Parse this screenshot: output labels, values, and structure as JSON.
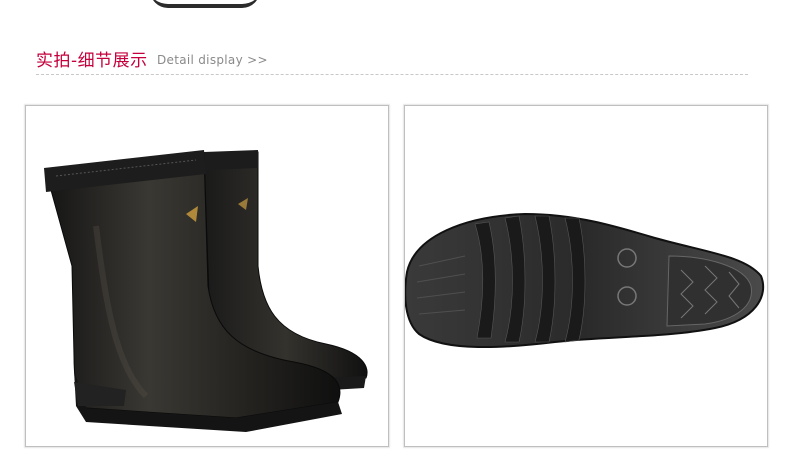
{
  "section": {
    "title_cn": "实拍-细节展示",
    "title_en": "Detail display >>"
  },
  "images": [
    {
      "name": "boots-side-photo",
      "subject": "black rubber rain boots pair"
    },
    {
      "name": "boot-sole-photo",
      "subject": "black rubber boot sole tread"
    }
  ]
}
